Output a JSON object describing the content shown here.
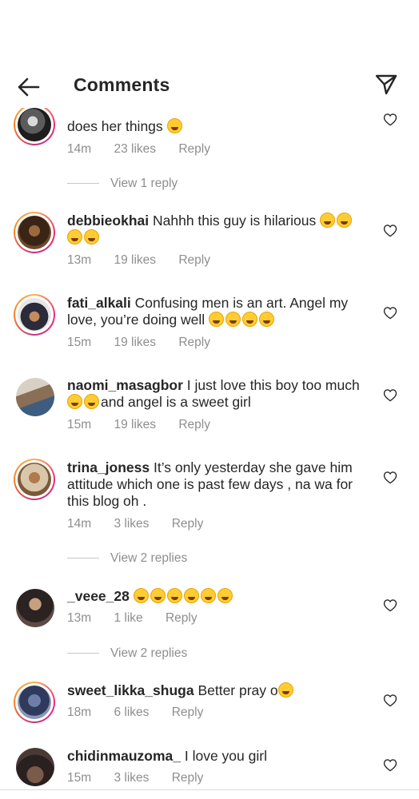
{
  "header": {
    "title": "Comments",
    "back_icon": "arrow-left-icon",
    "send_icon": "paper-plane-icon"
  },
  "comments": [
    {
      "username": "",
      "text": "does her things",
      "emoji_count": 1,
      "time": "14m",
      "likes": "23 likes",
      "reply": "Reply",
      "view_replies": "View 1 reply"
    },
    {
      "username": "debbieokhai",
      "text": "Nahhh this guy is hilarious",
      "emoji_count": 4,
      "time": "13m",
      "likes": "19 likes",
      "reply": "Reply"
    },
    {
      "username": "fati_alkali",
      "text": "Confusing men is an art. Angel my love, you’re doing well",
      "emoji_count": 4,
      "time": "15m",
      "likes": "19 likes",
      "reply": "Reply"
    },
    {
      "username": "naomi_masagbor",
      "text": "I just love this boy too much",
      "text2": "and angel is a sweet girl",
      "emoji_count": 2,
      "time": "15m",
      "likes": "19 likes",
      "reply": "Reply"
    },
    {
      "username": "trina_joness",
      "text": "It’s only yesterday she gave him attitude which one is past few days , na wa for this blog oh .",
      "time": "14m",
      "likes": "3 likes",
      "reply": "Reply",
      "view_replies": "View 2 replies"
    },
    {
      "username": "_veee_28",
      "text": "",
      "emoji_count": 6,
      "time": "13m",
      "likes": "1 like",
      "reply": "Reply",
      "view_replies": "View 2 replies"
    },
    {
      "username": "sweet_likka_shuga",
      "text": "Better pray o",
      "emoji_count": 1,
      "time": "18m",
      "likes": "6 likes",
      "reply": "Reply"
    },
    {
      "username": "chidinmauzoma_",
      "text": "I love you girl",
      "time": "15m",
      "likes": "3 likes",
      "reply": "Reply"
    }
  ],
  "colors": {
    "text": "#262626",
    "muted": "#8e8e8e",
    "ring_start": "#f9b24e",
    "ring_mid": "#ee2a7b",
    "emoji": "#ffcc33"
  }
}
